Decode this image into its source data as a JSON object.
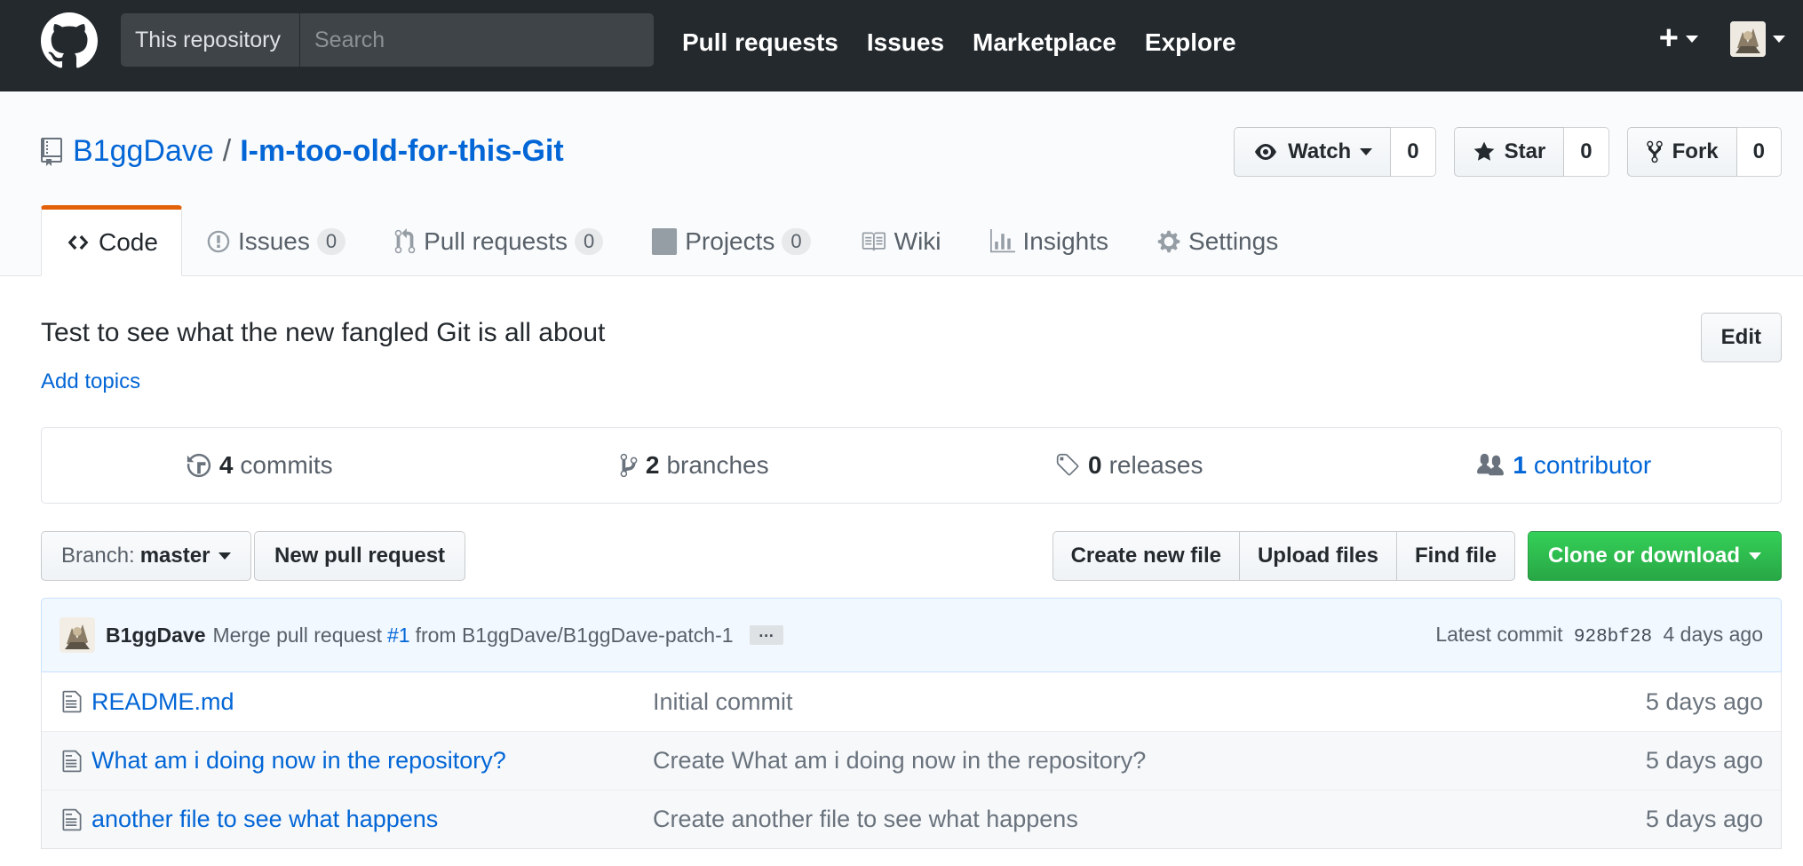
{
  "header": {
    "search_scope": "This repository",
    "search_placeholder": "Search",
    "nav": [
      "Pull requests",
      "Issues",
      "Marketplace",
      "Explore"
    ],
    "plus": "+"
  },
  "repo": {
    "owner": "B1ggDave",
    "separator": "/",
    "name": "I-m-too-old-for-this-Git",
    "actions": {
      "watch": {
        "label": "Watch",
        "count": "0"
      },
      "star": {
        "label": "Star",
        "count": "0"
      },
      "fork": {
        "label": "Fork",
        "count": "0"
      }
    },
    "tabs": [
      {
        "label": "Code",
        "counter": null
      },
      {
        "label": "Issues",
        "counter": "0"
      },
      {
        "label": "Pull requests",
        "counter": "0"
      },
      {
        "label": "Projects",
        "counter": "0"
      },
      {
        "label": "Wiki",
        "counter": null
      },
      {
        "label": "Insights",
        "counter": null
      },
      {
        "label": "Settings",
        "counter": null
      }
    ],
    "description": "Test to see what the new fangled Git is all about",
    "add_topics": "Add topics",
    "edit": "Edit"
  },
  "summary": {
    "commits": {
      "num": "4",
      "label": "commits"
    },
    "branches": {
      "num": "2",
      "label": "branches"
    },
    "releases": {
      "num": "0",
      "label": "releases"
    },
    "contributors": {
      "num": "1",
      "label": "contributor"
    }
  },
  "file_nav": {
    "branch_label": "Branch:",
    "branch_name": "master",
    "new_pr": "New pull request",
    "create_file": "Create new file",
    "upload_files": "Upload files",
    "find_file": "Find file",
    "clone": "Clone or download"
  },
  "latest_commit": {
    "author": "B1ggDave",
    "message_pre": "Merge pull request",
    "issue": "#1",
    "message_post": "from B1ggDave/B1ggDave-patch-1",
    "ellipsis": "…",
    "label": "Latest commit",
    "sha": "928bf28",
    "age": "4 days ago"
  },
  "files": [
    {
      "name": "README.md",
      "message": "Initial commit",
      "age": "5 days ago"
    },
    {
      "name": "What am i doing now in the repository?",
      "message": "Create What am i doing now in the repository?",
      "age": "5 days ago"
    },
    {
      "name": "another file to see what happens",
      "message": "Create another file to see what happens",
      "age": "5 days ago"
    }
  ],
  "colors": {
    "header_bg": "#24292e",
    "link": "#0366d6",
    "selected_tab": "#e36209",
    "clone_green": "#28a745",
    "commit_bg": "#f1f8ff"
  },
  "icons": [
    "github-logo-icon",
    "repo-icon",
    "eye-icon",
    "star-icon",
    "fork-icon",
    "code-icon",
    "issue-icon",
    "pull-request-icon",
    "project-icon",
    "wiki-icon",
    "graph-icon",
    "gear-icon",
    "history-icon",
    "branch-icon",
    "tag-icon",
    "people-icon",
    "file-icon"
  ]
}
